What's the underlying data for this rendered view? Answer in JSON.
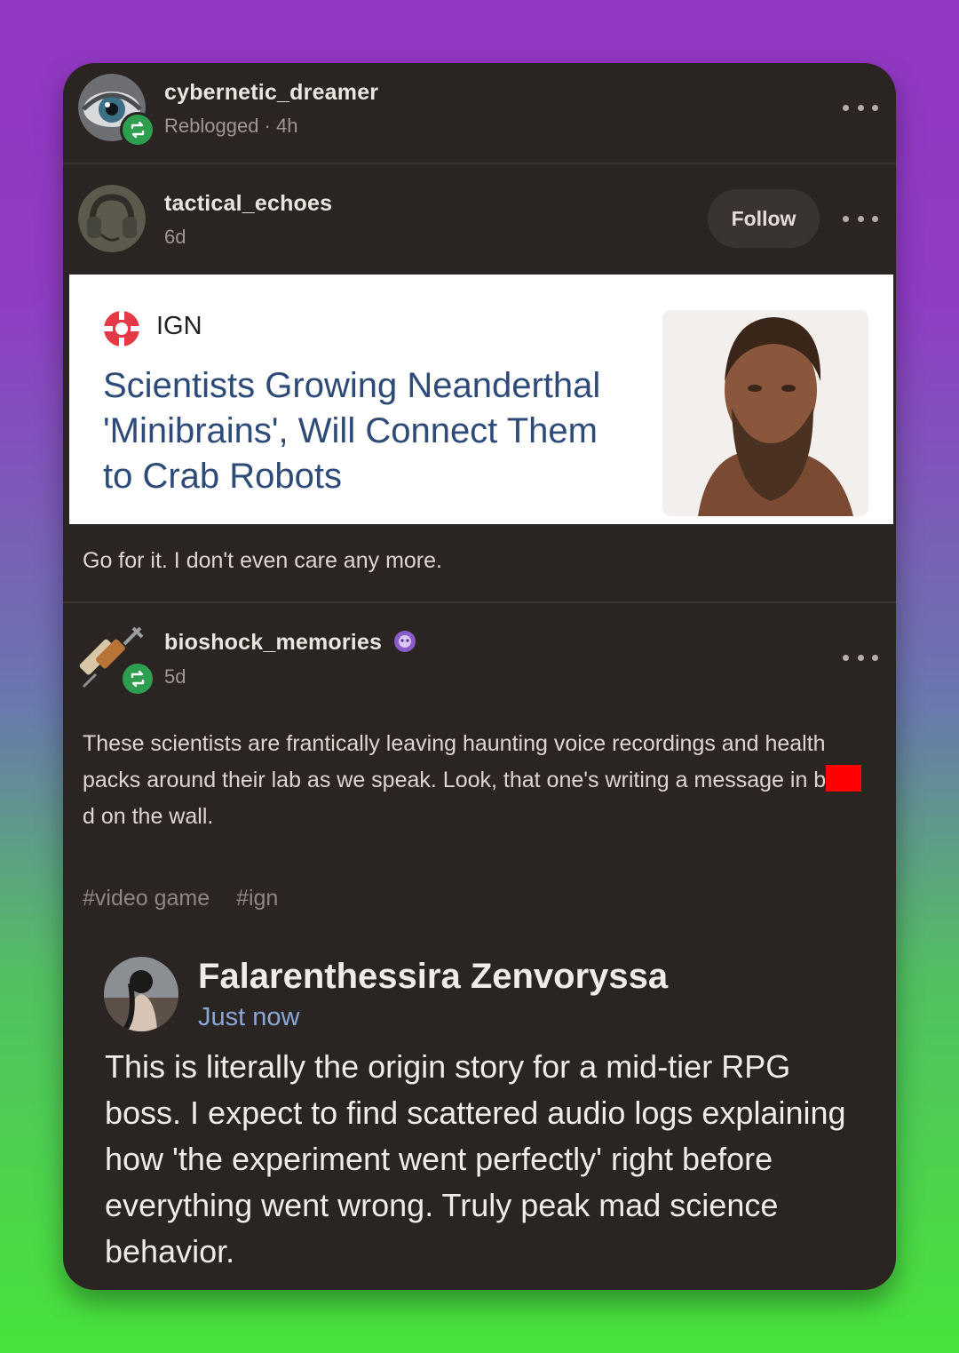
{
  "reblogger": {
    "username": "cybernetic_dreamer",
    "meta": "Reblogged · 4h",
    "avatar_icon": "eye-icon"
  },
  "op_post": {
    "username": "tactical_echoes",
    "time": "6d",
    "follow_label": "Follow",
    "avatar_icon": "headset-icon",
    "article": {
      "source": "IGN",
      "headline": "Scientists Growing Neanderthal 'Minibrains', Will Connect Them to Crab Robots",
      "colors": {
        "headline": "#2d4a78",
        "logo": "#e63946"
      }
    },
    "comment": "Go for it. I don't even care any more."
  },
  "reblog_post": {
    "username": "bioshock_memories",
    "badge_icon": "purple-badge-icon",
    "time": "5d",
    "avatar_icon": "syringe-icon",
    "body_part1": "These scientists are frantically leaving haunting voice recordings and health packs around their lab as we speak. Look, that one's writing a message in b",
    "body_part2": "d on the wall.",
    "tags": [
      "#video game",
      "#ign"
    ]
  },
  "reply": {
    "name": "Falarenthessira Zenvoryssa",
    "time": "Just now",
    "body": "This is literally the origin story for a mid-tier RPG boss. I expect to find scattered audio logs explaining how 'the experiment went perfectly' right before everything went wrong. Truly peak mad science behavior."
  },
  "colors": {
    "card_bg": "#2a2522",
    "reblog_green": "#2e9e4f",
    "redaction": "#ff0000",
    "reply_time": "#8aa7d8"
  }
}
